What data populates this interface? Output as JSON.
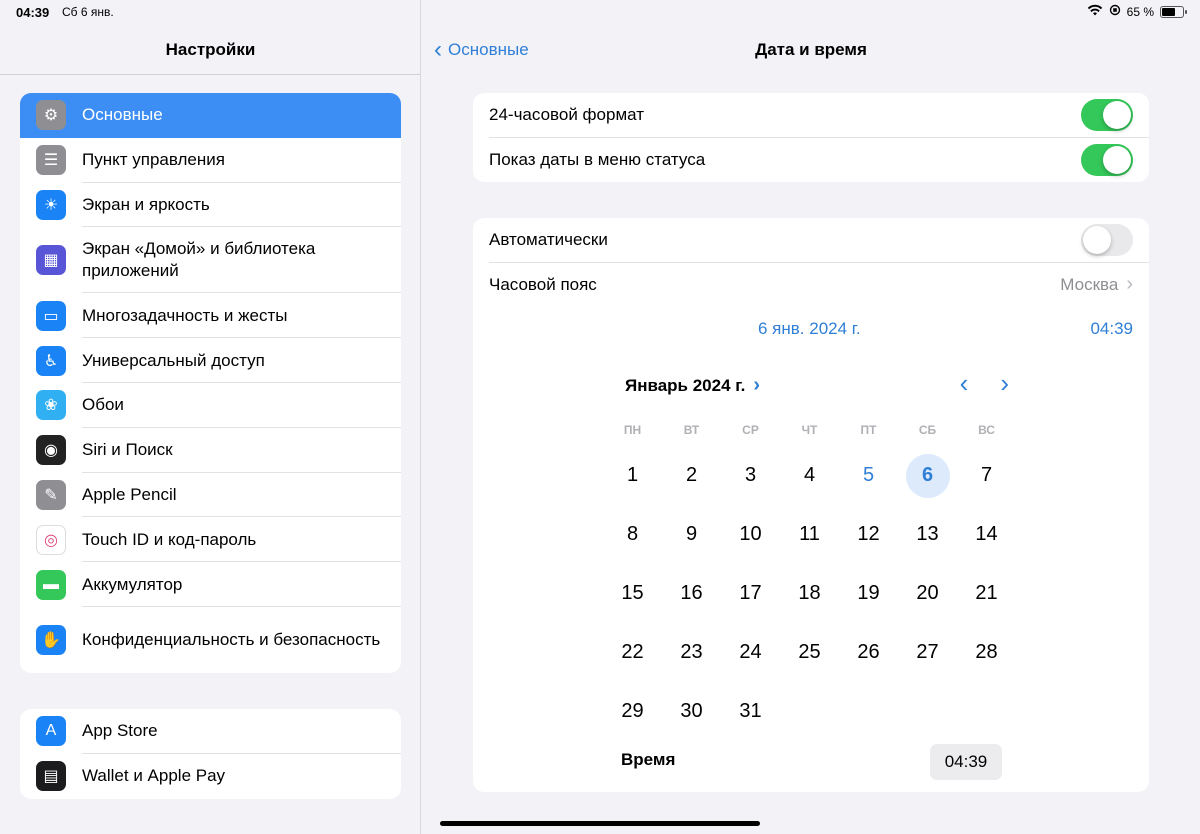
{
  "status_bar": {
    "time": "04:39",
    "date": "Сб 6 янв.",
    "battery": "65 %",
    "battery_level": 0.65
  },
  "sidebar": {
    "title": "Настройки",
    "group1": [
      {
        "label": "Основные",
        "icon": "gear-icon",
        "color": "#8e8e93",
        "selected": true
      },
      {
        "label": "Пункт управления",
        "icon": "switches-icon",
        "color": "#8e8e93"
      },
      {
        "label": "Экран и яркость",
        "icon": "sun-icon",
        "color": "#1a84f6"
      },
      {
        "label": "Экран «Домой» и библиотека приложений",
        "icon": "app-grid-icon",
        "color": "#5856d6"
      },
      {
        "label": "Многозадачность и жесты",
        "icon": "multitask-icon",
        "color": "#1a84f6"
      },
      {
        "label": "Универсальный доступ",
        "icon": "accessibility-icon",
        "color": "#1a84f6"
      },
      {
        "label": "Обои",
        "icon": "flower-icon",
        "color": "#30aff3"
      },
      {
        "label": "Siri и Поиск",
        "icon": "siri-icon",
        "color": "#222"
      },
      {
        "label": "Apple Pencil",
        "icon": "pencil-icon",
        "color": "#8e8e93"
      },
      {
        "label": "Touch ID и код-пароль",
        "icon": "fingerprint-icon",
        "color": "#ffffff"
      },
      {
        "label": "Аккумулятор",
        "icon": "battery-icon",
        "color": "#34c759"
      },
      {
        "label": "Конфиденциальность и безопасность",
        "icon": "hand-icon",
        "color": "#1a84f6"
      }
    ],
    "group2": [
      {
        "label": "App Store",
        "icon": "app-store-icon",
        "color": "#1a84f6"
      },
      {
        "label": "Wallet и Apple Pay",
        "icon": "wallet-icon",
        "color": "#1c1c1e"
      }
    ]
  },
  "main": {
    "back_label": "Основные",
    "title": "Дата и время",
    "format_24h_label": "24-часовой формат",
    "format_24h_on": true,
    "show_date_label": "Показ даты в меню статуса",
    "show_date_on": true,
    "auto_label": "Автоматически",
    "auto_on": false,
    "timezone_label": "Часовой пояс",
    "timezone_value": "Москва",
    "selected_date": "6 янв. 2024 г.",
    "selected_time": "04:39",
    "month_label": "Январь 2024 г.",
    "weekdays": [
      "ПН",
      "ВТ",
      "СР",
      "ЧТ",
      "ПТ",
      "СБ",
      "ВС"
    ],
    "weeks": [
      [
        "1",
        "2",
        "3",
        "4",
        "5",
        "6",
        "7"
      ],
      [
        "8",
        "9",
        "10",
        "11",
        "12",
        "13",
        "14"
      ],
      [
        "15",
        "16",
        "17",
        "18",
        "19",
        "20",
        "21"
      ],
      [
        "22",
        "23",
        "24",
        "25",
        "26",
        "27",
        "28"
      ],
      [
        "29",
        "30",
        "31",
        "",
        "",
        "",
        ""
      ]
    ],
    "today_day": "5",
    "selected_day": "6",
    "time_label": "Время",
    "time_value": "04:39"
  }
}
